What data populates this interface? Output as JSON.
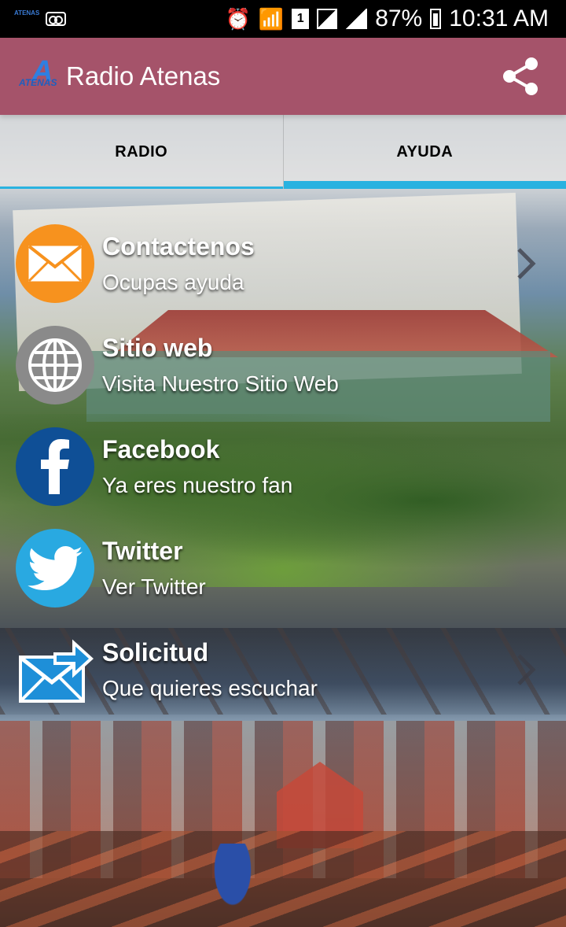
{
  "status_bar": {
    "battery": "87%",
    "time": "10:31 AM",
    "sim_slot": "1",
    "mini_logo_text": "ATENAS"
  },
  "app_bar": {
    "logo_letter": "A",
    "logo_word": "ATENAS",
    "title": "Radio Atenas"
  },
  "tabs": [
    {
      "label": "RADIO",
      "selected": false
    },
    {
      "label": "AYUDA",
      "selected": true
    }
  ],
  "menu": {
    "items": [
      {
        "title": "Contactenos",
        "subtitle": "Ocupas ayuda",
        "icon": "envelope-icon",
        "color": "#f7921e"
      },
      {
        "title": "Sitio web",
        "subtitle": "Visita Nuestro Sitio Web",
        "icon": "globe-icon",
        "color": "#8a8a8a"
      },
      {
        "title": "Facebook",
        "subtitle": "Ya eres nuestro fan",
        "icon": "facebook-icon",
        "color": "#0f4f96"
      },
      {
        "title": "Twitter",
        "subtitle": "Ver Twitter",
        "icon": "twitter-icon",
        "color": "#29a9e1"
      },
      {
        "title": "Solicitud",
        "subtitle": "Que quieres escuchar",
        "icon": "send-mail-icon",
        "color": "#1e8fd8"
      }
    ]
  },
  "colors": {
    "app_bar": "#a5536a",
    "tab_indicator": "#29b2e0"
  }
}
